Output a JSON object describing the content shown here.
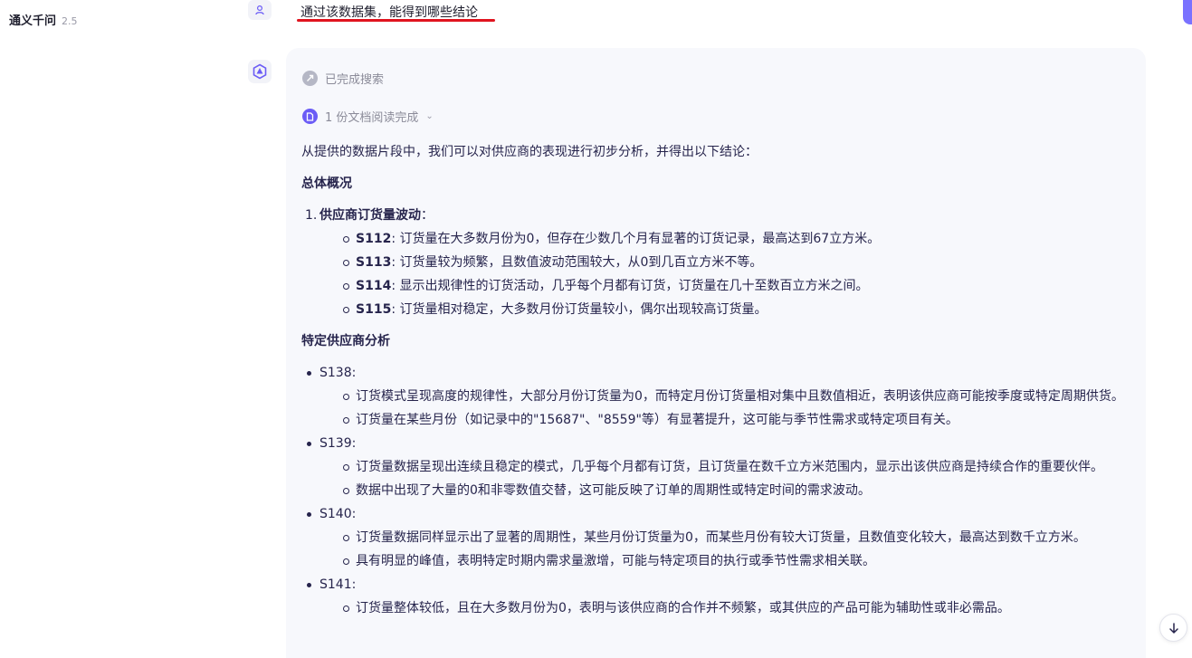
{
  "app": {
    "name": "通义千问",
    "version": "2.5"
  },
  "question": "通过该数据集，能得到哪些结论",
  "status": {
    "search_done": "已完成搜索",
    "doc_read": "1 份文档阅读完成"
  },
  "answer": {
    "intro": "从提供的数据片段中，我们可以对供应商的表现进行初步分析，并得出以下结论：",
    "section1_title": "总体概况",
    "item1": {
      "num": "1.",
      "title": "供应商订货量波动",
      "colon": "：",
      "points": [
        {
          "code": "S112",
          "text": ": 订货量在大多数月份为0，但存在少数几个月有显著的订货记录，最高达到67立方米。"
        },
        {
          "code": "S113",
          "text": ": 订货量较为频繁，且数值波动范围较大，从0到几百立方米不等。"
        },
        {
          "code": "S114",
          "text": ": 显示出规律性的订货活动，几乎每个月都有订货，订货量在几十至数百立方米之间。"
        },
        {
          "code": "S115",
          "text": ": 订货量相对稳定，大多数月份订货量较小，偶尔出现较高订货量。"
        }
      ]
    },
    "section2_title": "特定供应商分析",
    "suppliers": [
      {
        "code": "S138:",
        "points": [
          "订货模式呈现高度的规律性，大部分月份订货量为0，而特定月份订货量相对集中且数值相近，表明该供应商可能按季度或特定周期供货。",
          "订货量在某些月份（如记录中的\"15687\"、\"8559\"等）有显著提升，这可能与季节性需求或特定项目有关。"
        ]
      },
      {
        "code": "S139:",
        "points": [
          "订货量数据呈现出连续且稳定的模式，几乎每个月都有订货，且订货量在数千立方米范围内，显示出该供应商是持续合作的重要伙伴。",
          "数据中出现了大量的0和非零数值交替，这可能反映了订单的周期性或特定时间的需求波动。"
        ]
      },
      {
        "code": "S140:",
        "points": [
          "订货量数据同样显示出了显著的周期性，某些月份订货量为0，而某些月份有较大订货量，且数值变化较大，最高达到数千立方米。",
          "具有明显的峰值，表明特定时期内需求量激增，可能与特定项目的执行或季节性需求相关联。"
        ]
      },
      {
        "code": "S141:",
        "points": [
          "订货量整体较低，且在大多数月份为0，表明与该供应商的合作并不频繁，或其供应的产品可能为辅助性或非必需品。"
        ]
      }
    ]
  }
}
